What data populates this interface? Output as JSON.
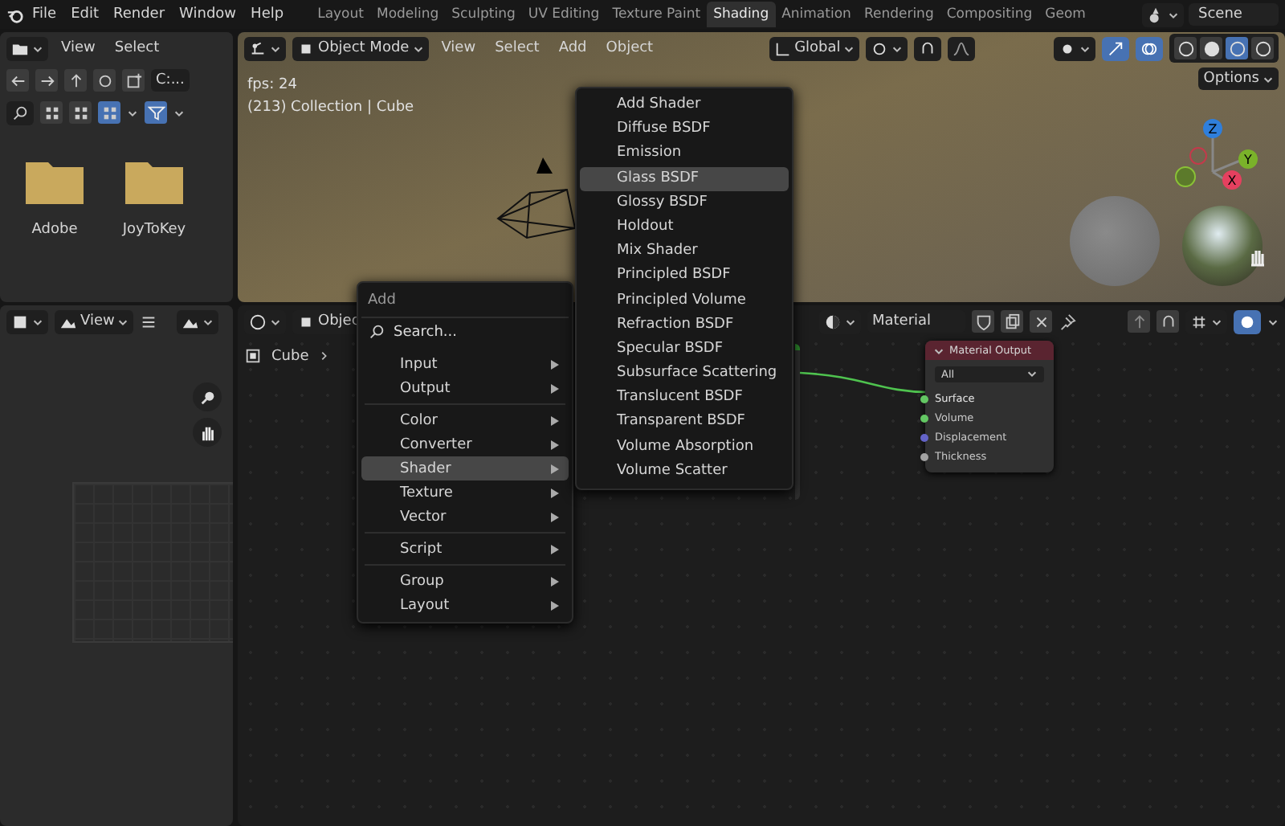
{
  "menubar": {
    "items": [
      "File",
      "Edit",
      "Render",
      "Window",
      "Help"
    ]
  },
  "workspace_tabs": [
    {
      "label": "Layout",
      "selected": false
    },
    {
      "label": "Modeling",
      "selected": false
    },
    {
      "label": "Sculpting",
      "selected": false
    },
    {
      "label": "UV Editing",
      "selected": false
    },
    {
      "label": "Texture Paint",
      "selected": false
    },
    {
      "label": "Shading",
      "selected": true
    },
    {
      "label": "Animation",
      "selected": false
    },
    {
      "label": "Rendering",
      "selected": false
    },
    {
      "label": "Compositing",
      "selected": false
    },
    {
      "label": "Geom",
      "selected": false
    }
  ],
  "scene": {
    "name": "Scene"
  },
  "file_browser": {
    "menus": [
      "View",
      "Select"
    ],
    "path": "C:...",
    "view_modes": [
      {
        "selected": false
      },
      {
        "selected": false
      },
      {
        "selected": true
      }
    ],
    "filter_on": true,
    "folders": [
      "Adobe",
      "JoyToKey"
    ]
  },
  "viewport": {
    "mode": "Object Mode",
    "menus": [
      "View",
      "Select",
      "Add",
      "Object"
    ],
    "orientation": "Global",
    "options": "Options",
    "fps": "fps: 24",
    "info": "(213) Collection | Cube",
    "axes": [
      "Z",
      "Y",
      "X"
    ],
    "shading_modes": [
      {
        "selected": false
      },
      {
        "selected": false
      },
      {
        "selected": true
      },
      {
        "selected": false
      }
    ]
  },
  "image_editor": {
    "menus": [
      "View"
    ]
  },
  "node_editor": {
    "mode": "Objec",
    "breadcrumb": "Cube",
    "material": "Material",
    "node": {
      "title": "Material Output",
      "target": "All",
      "sockets": [
        {
          "label": "Surface",
          "color": "#63c763",
          "connected": true
        },
        {
          "label": "Volume",
          "color": "#63c763",
          "connected": false
        },
        {
          "label": "Displacement",
          "color": "#6363c7",
          "connected": false
        },
        {
          "label": "Thickness",
          "color": "#a1a1a1",
          "connected": false
        }
      ]
    }
  },
  "add_menu": {
    "title": "Add",
    "search_placeholder": "Search...",
    "items": [
      {
        "kind": "item",
        "label": "Input",
        "selected": false
      },
      {
        "kind": "item",
        "label": "Output",
        "selected": false
      },
      {
        "kind": "separator"
      },
      {
        "kind": "item",
        "label": "Color",
        "selected": false
      },
      {
        "kind": "item",
        "label": "Converter",
        "selected": false
      },
      {
        "kind": "item",
        "label": "Shader",
        "selected": true
      },
      {
        "kind": "item",
        "label": "Texture",
        "selected": false
      },
      {
        "kind": "item",
        "label": "Vector",
        "selected": false
      },
      {
        "kind": "separator"
      },
      {
        "kind": "item",
        "label": "Script",
        "selected": false
      },
      {
        "kind": "separator"
      },
      {
        "kind": "item",
        "label": "Group",
        "selected": false
      },
      {
        "kind": "item",
        "label": "Layout",
        "selected": false
      }
    ]
  },
  "shader_submenu": {
    "items": [
      {
        "label": "Add Shader",
        "selected": false
      },
      {
        "label": "Diffuse BSDF",
        "selected": false
      },
      {
        "label": "Emission",
        "selected": false
      },
      {
        "label": "Glass BSDF",
        "selected": true
      },
      {
        "label": "Glossy BSDF",
        "selected": false
      },
      {
        "label": "Holdout",
        "selected": false
      },
      {
        "label": "Mix Shader",
        "selected": false
      },
      {
        "label": "Principled BSDF",
        "selected": false
      },
      {
        "label": "Principled Volume",
        "selected": false
      },
      {
        "label": "Refraction BSDF",
        "selected": false
      },
      {
        "label": "Specular BSDF",
        "selected": false
      },
      {
        "label": "Subsurface Scattering",
        "selected": false
      },
      {
        "label": "Translucent BSDF",
        "selected": false
      },
      {
        "label": "Transparent BSDF",
        "selected": false
      },
      {
        "label": "Volume Absorption",
        "selected": false
      },
      {
        "label": "Volume Scatter",
        "selected": false
      }
    ]
  }
}
